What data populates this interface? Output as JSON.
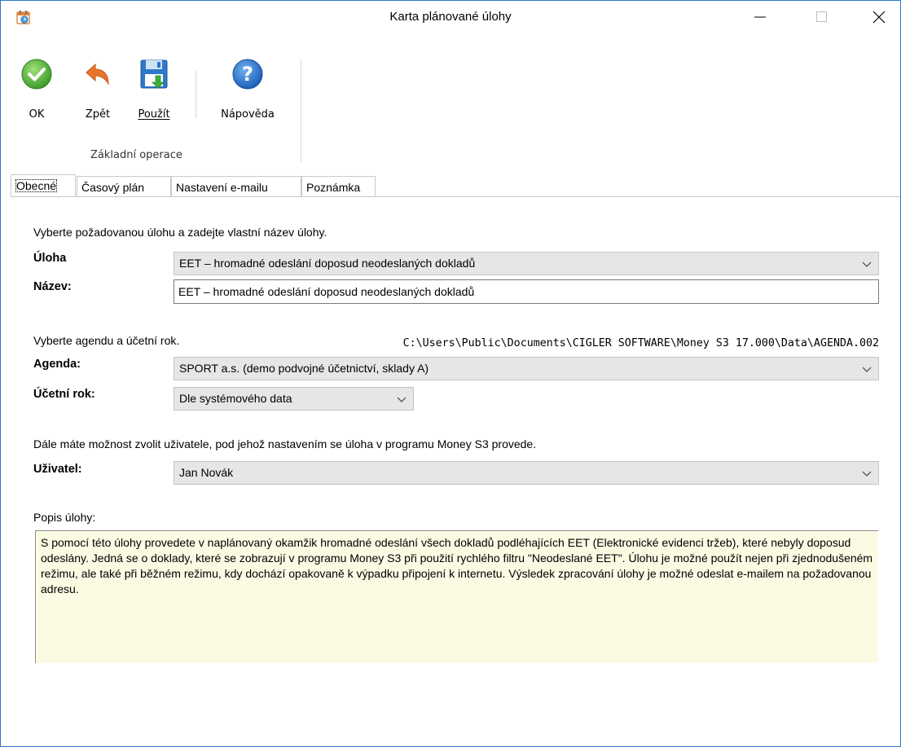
{
  "window": {
    "title": "Karta plánované úlohy",
    "icon": "scheduler-calendar-icon",
    "controls": {
      "minimize": "minimize-icon",
      "maximize": "maximize-icon",
      "close": "close-icon"
    }
  },
  "ribbon": {
    "buttons": [
      {
        "label": "OK",
        "icon": "ok-check-icon"
      },
      {
        "label": "Zpět",
        "icon": "back-arrow-icon"
      },
      {
        "label": "Použít",
        "icon": "save-floppy-icon"
      },
      {
        "label": "Nápověda",
        "icon": "help-question-icon"
      }
    ],
    "group_label": "Základní operace"
  },
  "tabs": [
    {
      "label": "Obecné",
      "active": true
    },
    {
      "label": "Časový plán",
      "active": false
    },
    {
      "label": "Nastavení e-mailu",
      "active": false
    },
    {
      "label": "Poznámka",
      "active": false
    }
  ],
  "form": {
    "task_hint": "Vyberte požadovanou úlohu a zadejte vlastní název úlohy.",
    "task_label": "Úloha",
    "task_value": "EET – hromadné odeslání doposud neodeslaných dokladů",
    "name_label": "Název:",
    "name_value": "EET – hromadné odeslání doposud neodeslaných dokladů",
    "agenda_hint": "Vyberte agendu a účetní rok.",
    "agenda_path": "C:\\Users\\Public\\Documents\\CIGLER SOFTWARE\\Money S3 17.000\\Data\\AGENDA.002",
    "agenda_label": "Agenda:",
    "agenda_value": "SPORT a.s. (demo podvojné účetnictví, sklady A)",
    "year_label": "Účetní rok:",
    "year_value": "Dle systémového data",
    "user_hint": "Dále máte možnost zvolit uživatele, pod jehož nastavením se úloha v programu Money S3 provede.",
    "user_label": "Uživatel:",
    "user_value": "Jan Novák",
    "desc_label": "Popis úlohy:",
    "desc_text": "S pomocí této úlohy provedete v naplánovaný okamžik hromadné odeslání všech dokladů podléhajících EET (Elektronické evidenci tržeb), které nebyly doposud odeslány. Jedná se o doklady, které se zobrazují v programu Money S3 při použití rychlého filtru \"Neodeslané EET\". Úlohu je možné použít nejen při zjednodušeném režimu, ale také při běžném režimu, kdy dochází opakovaně k výpadku připojení k internetu. Výsledek zpracování úlohy je možné odeslat e-mailem na požadovanou adresu."
  }
}
